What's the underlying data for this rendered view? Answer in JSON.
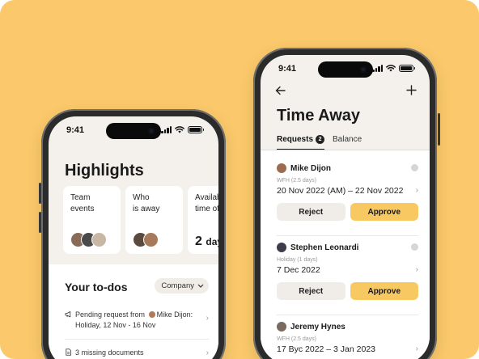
{
  "colors": {
    "background": "#fbc96b",
    "approve": "#f8c962",
    "reject": "#f0ede8",
    "screen_bg": "#f4f1ec"
  },
  "left_phone": {
    "status_time": "9:41",
    "title": "Highlights",
    "cards": [
      {
        "label": "Team events",
        "line1": "Team",
        "line2": "events"
      },
      {
        "label": "Who is away",
        "line1": "Who",
        "line2": "is away"
      },
      {
        "label": "Available time off",
        "line1": "Available",
        "line2": "time off",
        "value": "2",
        "unit": "days"
      }
    ],
    "todo": {
      "title": "Your to-dos",
      "filter": "Company",
      "items": [
        {
          "icon": "megaphone-icon",
          "text_before": "Pending request from",
          "person": "Mike Dijon:",
          "text_after": "Holiday, 12 Nov - 16 Nov"
        },
        {
          "icon": "document-icon",
          "text": "3 missing documents"
        }
      ]
    }
  },
  "right_phone": {
    "status_time": "9:41",
    "title": "Time Away",
    "tabs": [
      {
        "label": "Requests",
        "count": "2",
        "active": true
      },
      {
        "label": "Balance",
        "active": false
      }
    ],
    "requests": [
      {
        "name": "Mike Dijon",
        "type": "WFH (2.5 days)",
        "dates": "20 Nov 2022 (AM) – 22 Nov 2022",
        "reject": "Reject",
        "approve": "Approve"
      },
      {
        "name": "Stephen Leonardi",
        "type": "Holiday (1 days)",
        "dates": "7 Dec 2022",
        "reject": "Reject",
        "approve": "Approve"
      },
      {
        "name": "Jeremy Hynes",
        "type": "WFH (2.5 days)",
        "dates": "17 Byc 2022 – 3 Jan 2023"
      }
    ]
  }
}
